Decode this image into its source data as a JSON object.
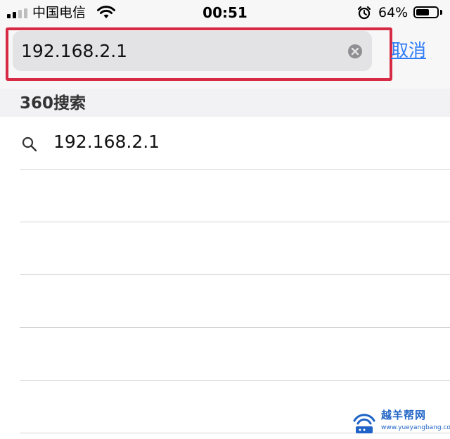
{
  "status_bar": {
    "carrier": "中国电信",
    "time": "00:51",
    "battery_percent_text": "64%",
    "battery_level": 0.64,
    "signal_bars": [
      true,
      true,
      false,
      false
    ],
    "icons": [
      "signal-icon",
      "wifi-icon",
      "alarm-icon",
      "battery-icon"
    ]
  },
  "search": {
    "query": "192.168.2.1",
    "cancel_label": "取消"
  },
  "suggestions": {
    "section_title": "360搜索",
    "items": [
      {
        "text": "192.168.2.1",
        "icon": "search-icon"
      }
    ]
  },
  "watermark": {
    "name": "越羊帮网",
    "url": "www.yueyangbang.com"
  },
  "colors": {
    "accent": "#2f7df6",
    "highlight": "#d72a44",
    "search_field": "#e3e3e5",
    "section_header": "#f2f2f4"
  }
}
